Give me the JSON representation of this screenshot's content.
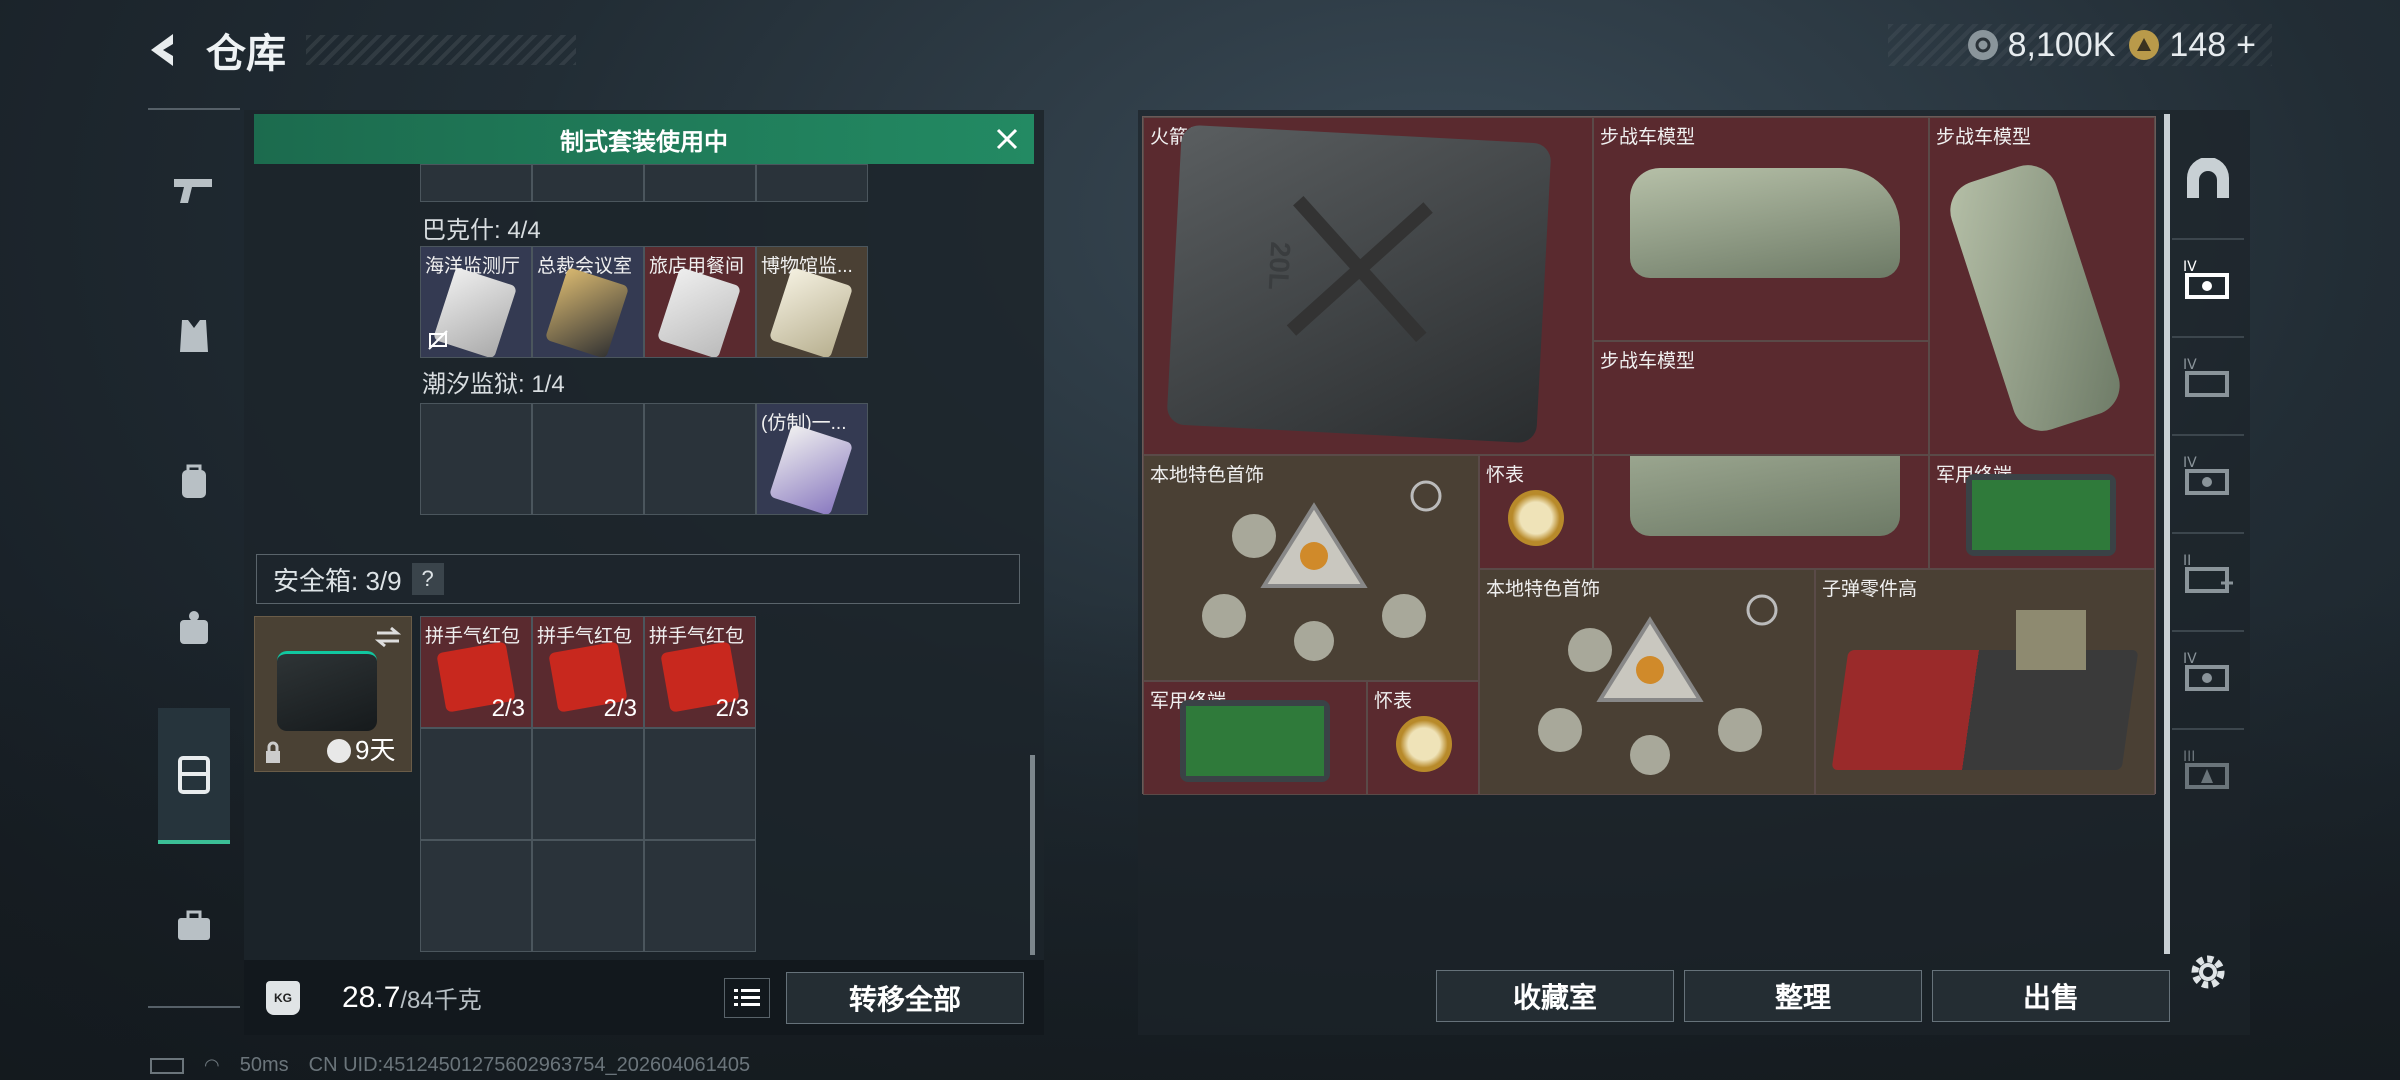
{
  "header": {
    "title": "仓库"
  },
  "currency": {
    "coins": "8,100K",
    "gold": "148",
    "plus": "+"
  },
  "left": {
    "banner": "制式套装使用中",
    "group1_label": "巴克什: 4/4",
    "group1_items": [
      "海洋监测厅",
      "总裁会议室",
      "旅店用餐间",
      "博物馆监..."
    ],
    "group2_label": "潮汐监狱: 1/4",
    "group2_items": [
      "",
      "",
      "",
      "(仿制)一..."
    ],
    "safe_label": "安全箱: 3/9",
    "safe_help": "?",
    "safe_time": "9天",
    "red_packets": [
      {
        "label": "拼手气红包",
        "count": "2/3"
      },
      {
        "label": "拼手气红包",
        "count": "2/3"
      },
      {
        "label": "拼手气红包",
        "count": "2/3"
      }
    ],
    "weight_value": "28.7",
    "weight_max": "/84千克",
    "weight_icon_text": "KG",
    "transfer_all": "转移全部"
  },
  "right": {
    "items": {
      "fuel": "火箭燃料",
      "ifv1": "步战车模型",
      "ifv2": "步战车模型",
      "ifv3": "步战车模型",
      "jewel1": "本地特色首饰",
      "watch1": "怀表",
      "terminal1": "军用终端",
      "jewel2": "本地特色首饰",
      "ammo": "子弹零件高",
      "terminal2": "军用终端",
      "watch2": "怀表"
    },
    "fuel_can_text": "20L",
    "collection": "收藏室",
    "sort": "整理",
    "sell": "出售"
  },
  "status": {
    "ping": "50ms",
    "uid": "CN UID:4512450127560296375​4_202604061405"
  },
  "colors": {
    "accent": "#3bbf96",
    "red_cell": "#5a2a2f",
    "tan_cell": "#4a4034",
    "banner": "#238a63"
  }
}
